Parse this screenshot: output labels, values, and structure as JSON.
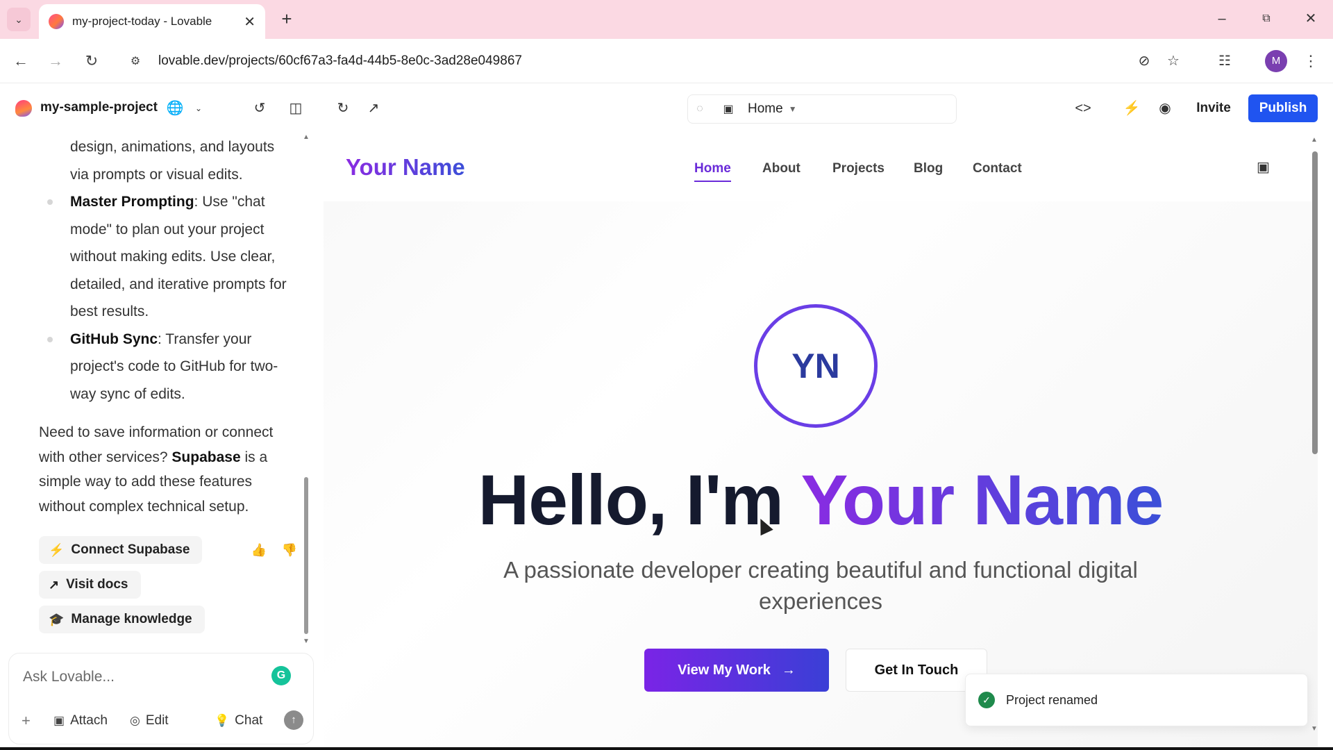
{
  "browser": {
    "tab_title": "my-project-today - Lovable",
    "url": "lovable.dev/projects/60cf67a3-fa4d-44b5-8e0c-3ad28e049867",
    "profile_initial": "M",
    "icons": [
      "tab-search-icon",
      "close-icon",
      "plus-icon",
      "minimize-icon",
      "restore-icon",
      "close-window-icon",
      "back-icon",
      "forward-icon",
      "reload-icon",
      "site-settings-icon",
      "eye-off-icon",
      "star-icon",
      "extensions-icon",
      "kebab-menu-icon"
    ]
  },
  "appbar": {
    "project_name": "my-sample-project",
    "route_label": "Home",
    "invite_label": "Invite",
    "publish_label": "Publish",
    "accent_color": "#2054f0"
  },
  "chat": {
    "intro_cont": "design, animations, and layouts via prompts or visual edits.",
    "bullets": [
      {
        "title": "Master Prompting",
        "text": ": Use \"chat mode\" to plan out your project without making edits. Use clear, detailed, and iterative prompts for best results."
      },
      {
        "title": "GitHub Sync",
        "text": ": Transfer your project's code to GitHub for two-way sync of edits."
      }
    ],
    "para_before": "Need to save information or connect with other services? ",
    "para_bold": "Supabase",
    "para_after": " is a simple way to add these features without complex technical setup.",
    "actions": {
      "connect": "Connect Supabase",
      "docs": "Visit docs",
      "knowledge": "Manage knowledge"
    },
    "composer": {
      "placeholder": "Ask Lovable...",
      "attach": "Attach",
      "edit": "Edit",
      "chat": "Chat"
    }
  },
  "preview": {
    "brand": "Your Name",
    "nav": [
      "Home",
      "About",
      "Projects",
      "Blog",
      "Contact"
    ],
    "avatar_initials": "YN",
    "hero_prefix": "Hello, I'm ",
    "hero_name": "Your Name",
    "subtitle": "A passionate developer creating beautiful and functional digital experiences",
    "cta_primary": "View My Work",
    "cta_secondary": "Get In Touch",
    "gradient_start": "#8a2be2",
    "gradient_end": "#3b4fd8"
  },
  "toast": {
    "text": "Project renamed",
    "status_color": "#1f8a4c"
  }
}
